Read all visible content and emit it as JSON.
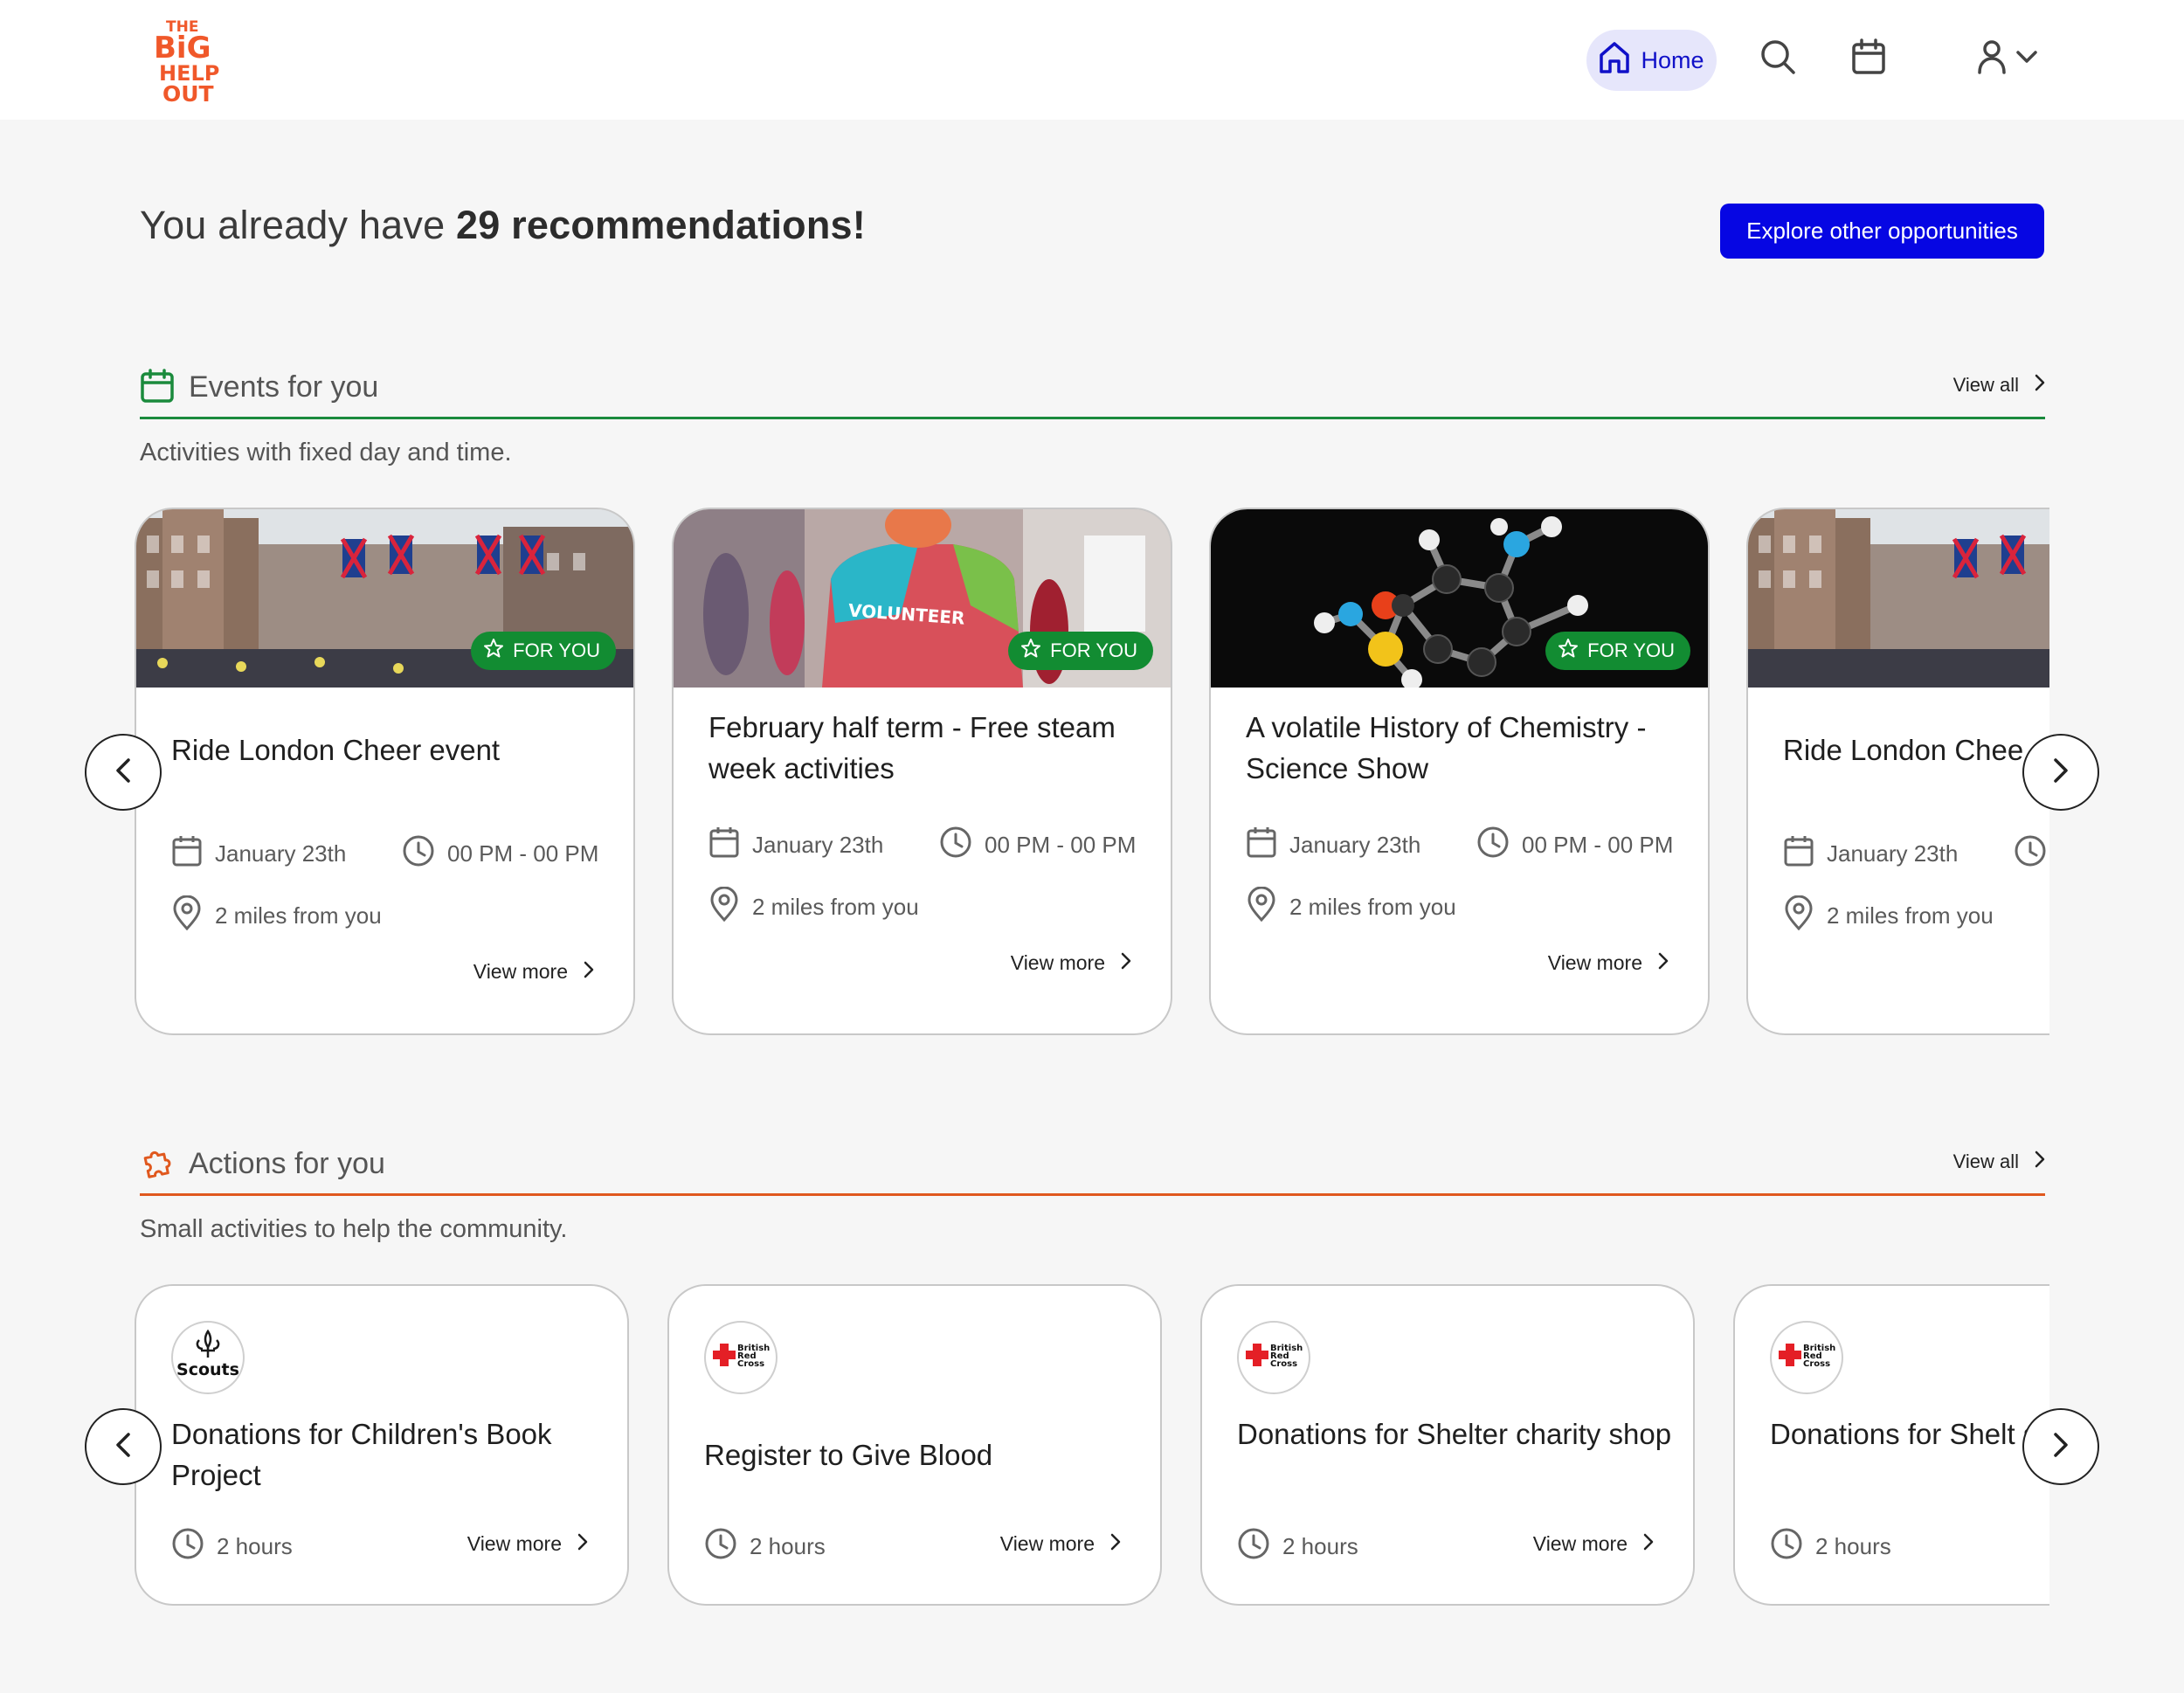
{
  "header": {
    "logo_alt": "THE BIG HELP OUT",
    "nav_home_label": "Home",
    "icons": [
      "home-icon",
      "search-icon",
      "calendar-icon",
      "user-icon",
      "chevron-down-icon"
    ]
  },
  "hero": {
    "prefix": "You already have ",
    "highlight": "29 recommendations!",
    "explore_button": "Explore other opportunities"
  },
  "events": {
    "title": "Events for you",
    "view_all": "View all",
    "subtitle": "Activities with fixed day and time.",
    "accent": "#1a8a3c",
    "cards": [
      {
        "badge": "FOR YOU",
        "title": "Ride London Cheer event",
        "date": "January 23th",
        "time": "00 PM - 00 PM",
        "distance": "2 miles from you",
        "view_more": "View more",
        "image": "street-with-flags"
      },
      {
        "badge": "FOR YOU",
        "title": "February half term - Free steam week activities",
        "date": "January 23th",
        "time": "00 PM - 00 PM",
        "distance": "2 miles from you",
        "view_more": "View more",
        "image": "volunteer-shirt",
        "image_text": "VOLUNTEER"
      },
      {
        "badge": "FOR YOU",
        "title": "A volatile History of Chemistry - Science Show",
        "date": "January 23th",
        "time": "00 PM - 00 PM",
        "distance": "2 miles from you",
        "view_more": "View more",
        "image": "molecule"
      },
      {
        "badge": "",
        "title": "Ride London Chee",
        "date": "January 23th",
        "time": "",
        "distance": "2 miles from you",
        "view_more": "",
        "image": "street-with-flags"
      }
    ]
  },
  "actions": {
    "title": "Actions for you",
    "view_all": "View all",
    "subtitle": "Small activities to help the community.",
    "accent": "#e0581e",
    "cards": [
      {
        "org": "Scouts",
        "title": "Donations for Children's Book Project",
        "duration": "2 hours",
        "view_more": "View more"
      },
      {
        "org": "British Red Cross",
        "title": "Register to Give Blood",
        "duration": "2 hours",
        "view_more": "View more"
      },
      {
        "org": "British Red Cross",
        "title": "Donations for Shelter charity shop",
        "duration": "2 hours",
        "view_more": "View more"
      },
      {
        "org": "British Red Cross",
        "title": "Donations for Shelt shop",
        "duration": "2 hours",
        "view_more": ""
      }
    ]
  },
  "colors": {
    "primary": "#0606e3",
    "badge_green": "#128c32",
    "nav_active_bg": "#e6e6fb",
    "logo_orange": "#f0582a"
  }
}
